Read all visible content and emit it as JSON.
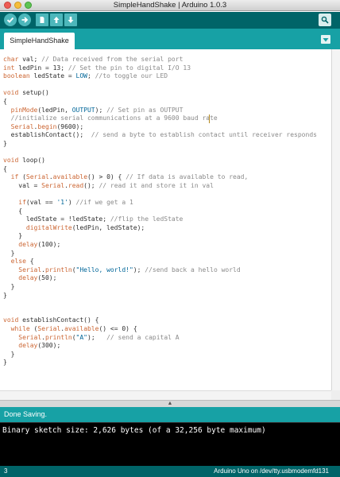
{
  "window": {
    "title": "SimpleHandShake | Arduino 1.0.3"
  },
  "toolbar": {
    "buttons": [
      "verify-icon",
      "upload-icon",
      "new-icon",
      "open-icon",
      "save-icon"
    ],
    "serial_monitor_icon": "magnifier-icon"
  },
  "tabs": [
    {
      "label": "SimpleHandShake"
    }
  ],
  "editor": {
    "lines": [
      "char val; // Data received from the serial port",
      "int ledPin = 13; // Set the pin to digital I/O 13",
      "boolean ledState = LOW; //to toggle our LED",
      "",
      "void setup()",
      "{",
      "  pinMode(ledPin, OUTPUT); // Set pin as OUTPUT",
      "  //initialize serial communications at a 9600 baud rate",
      "  Serial.begin(9600);",
      "  establishContact();  // send a byte to establish contact until receiver responds",
      "}",
      "",
      "void loop()",
      "{",
      "  if (Serial.available() > 0) { // If data is available to read,",
      "    val = Serial.read(); // read it and store it in val",
      "",
      "    if(val == '1') //if we get a 1",
      "    {",
      "      ledState = !ledState; //flip the ledState",
      "      digitalWrite(ledPin, ledState);",
      "    }",
      "    delay(100);",
      "  }",
      "  else {",
      "    Serial.println(\"Hello, world!\"); //send back a hello world",
      "    delay(50);",
      "  }",
      "}",
      "",
      "",
      "void establishContact() {",
      "  while (Serial.available() <= 0) {",
      "    Serial.println(\"A\");   // send a capital A",
      "    delay(300);",
      "  }",
      "}"
    ]
  },
  "status": {
    "message": "Done Saving."
  },
  "console": {
    "text": "Binary sketch size: 2,626 bytes (of a 32,256 byte maximum)"
  },
  "footer": {
    "line_number": "3",
    "board": "Arduino Uno on /dev/tty.usbmodemfd131"
  },
  "colors": {
    "toolbar": "#006468",
    "tabbar": "#17a1a5",
    "button": "#4db7bb",
    "keyword": "#cc6633",
    "comment": "#8a8a8a",
    "string": "#006699"
  }
}
